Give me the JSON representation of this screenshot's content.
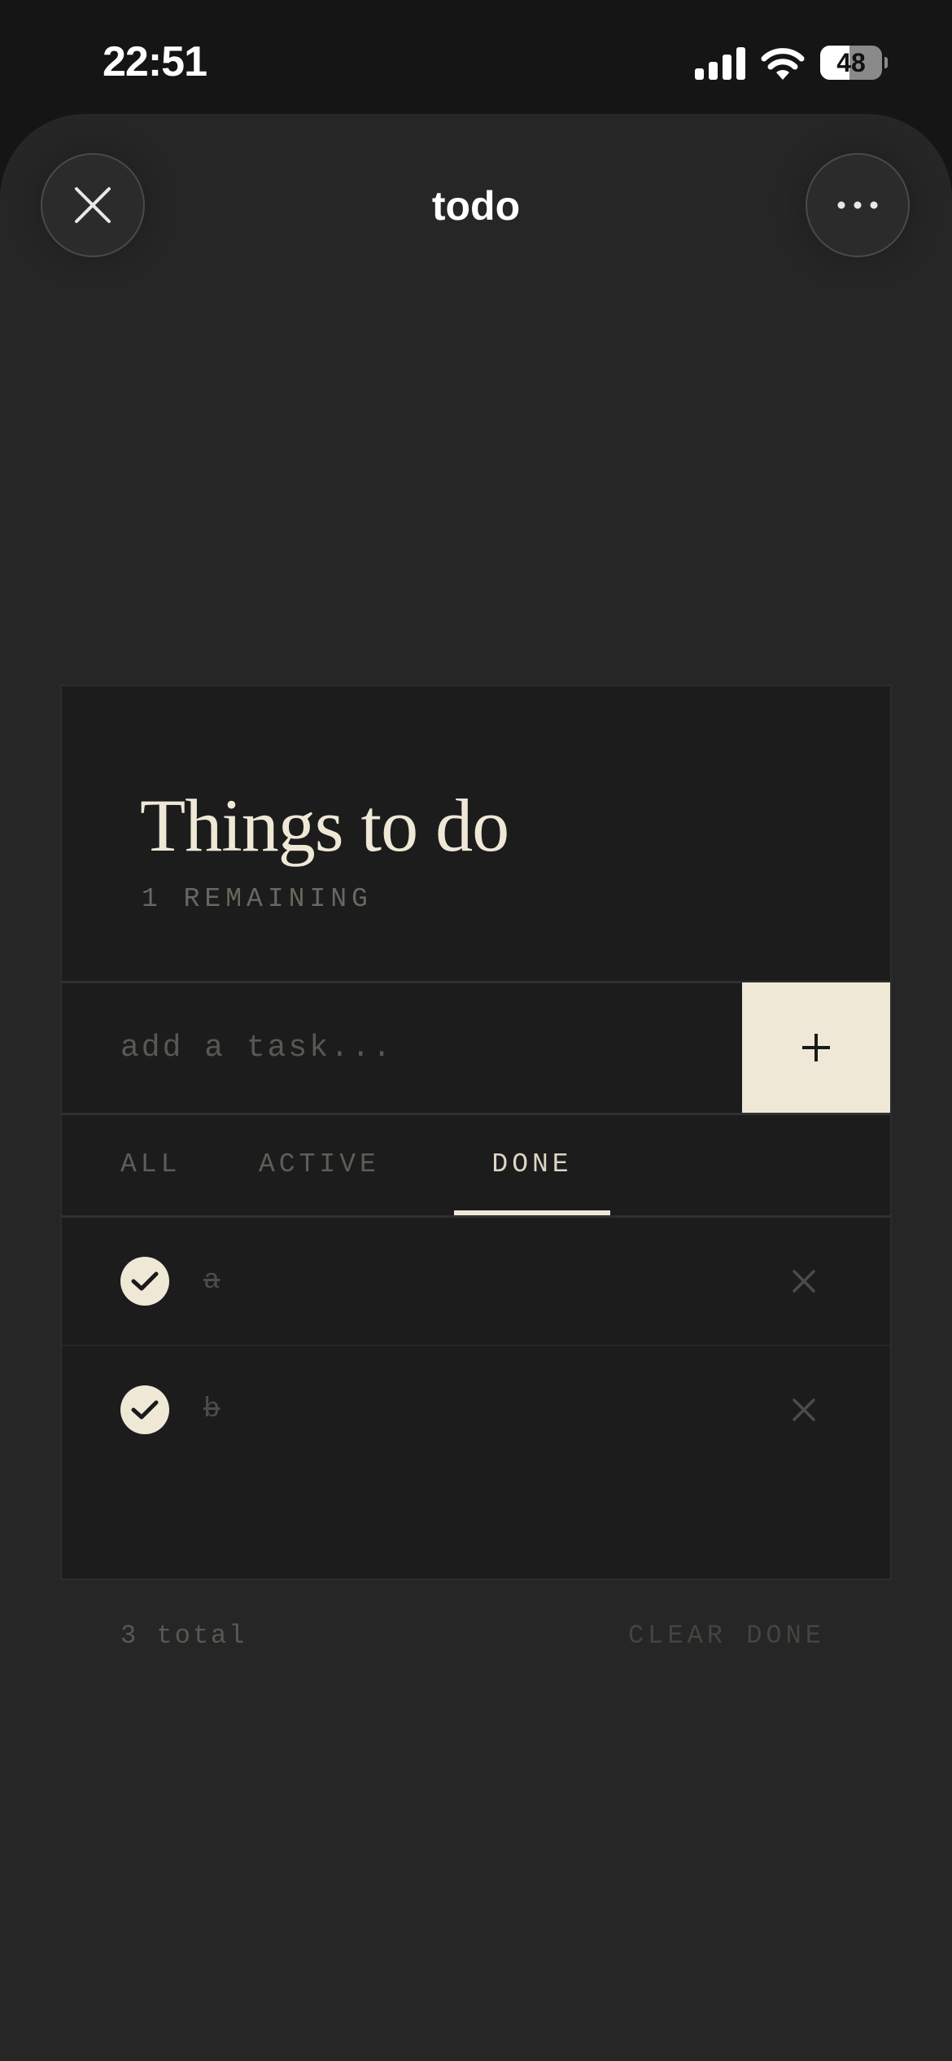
{
  "status_bar": {
    "time": "22:51",
    "battery_level": 48,
    "battery_label": "48",
    "icons": [
      "signal-icon",
      "wifi-icon",
      "battery-icon"
    ]
  },
  "header": {
    "title": "todo",
    "close_icon": "close-icon",
    "more_icon": "more-icon"
  },
  "card": {
    "title": "Things to do",
    "remaining": "1 REMAINING",
    "input": {
      "value": "",
      "placeholder": "add a task..."
    },
    "add_icon": "plus-icon",
    "tabs": [
      {
        "label": "ALL",
        "selected": false
      },
      {
        "label": "ACTIVE",
        "selected": false
      },
      {
        "label": "DONE",
        "selected": true
      }
    ],
    "items": [
      {
        "text": "a",
        "done": true
      },
      {
        "text": "b",
        "done": true
      }
    ],
    "footer": {
      "total": "3 total",
      "clear_label": "CLEAR DONE"
    }
  },
  "colors": {
    "background": "#151515",
    "sheet": "#262626",
    "card": "#1c1c1c",
    "accent": "#efe8d6"
  }
}
